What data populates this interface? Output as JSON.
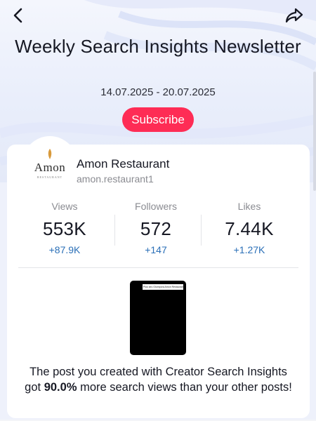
{
  "header": {
    "title": "Weekly Search Insights Newsletter",
    "date_range": "14.07.2025 - 20.07.2025",
    "subscribe_label": "Subscribe"
  },
  "profile": {
    "name": "Amon Restaurant",
    "handle": "amon.restaurant1",
    "logo_text": "Amon",
    "logo_subtext": "RESTAURANT"
  },
  "stats": [
    {
      "label": "Views",
      "value": "553K",
      "delta": "+87.9K"
    },
    {
      "label": "Followers",
      "value": "572",
      "delta": "+147"
    },
    {
      "label": "Likes",
      "value": "7.44K",
      "delta": "+1.27K"
    }
  ],
  "post": {
    "thumbnail_caption": "Plus seu Olumpora Amon Restaurant2 ..."
  },
  "message": {
    "line1": "The post you created with Creator Search Insights",
    "line2_prefix": "got ",
    "line2_highlight": "90.0%",
    "line2_suffix": " more search views than your other posts!"
  },
  "icons": {
    "back": "chevron-left-icon",
    "share": "share-arrow-icon"
  },
  "colors": {
    "accent": "#fe2c55",
    "delta": "#2a6fb7",
    "muted": "#8a8b91"
  }
}
